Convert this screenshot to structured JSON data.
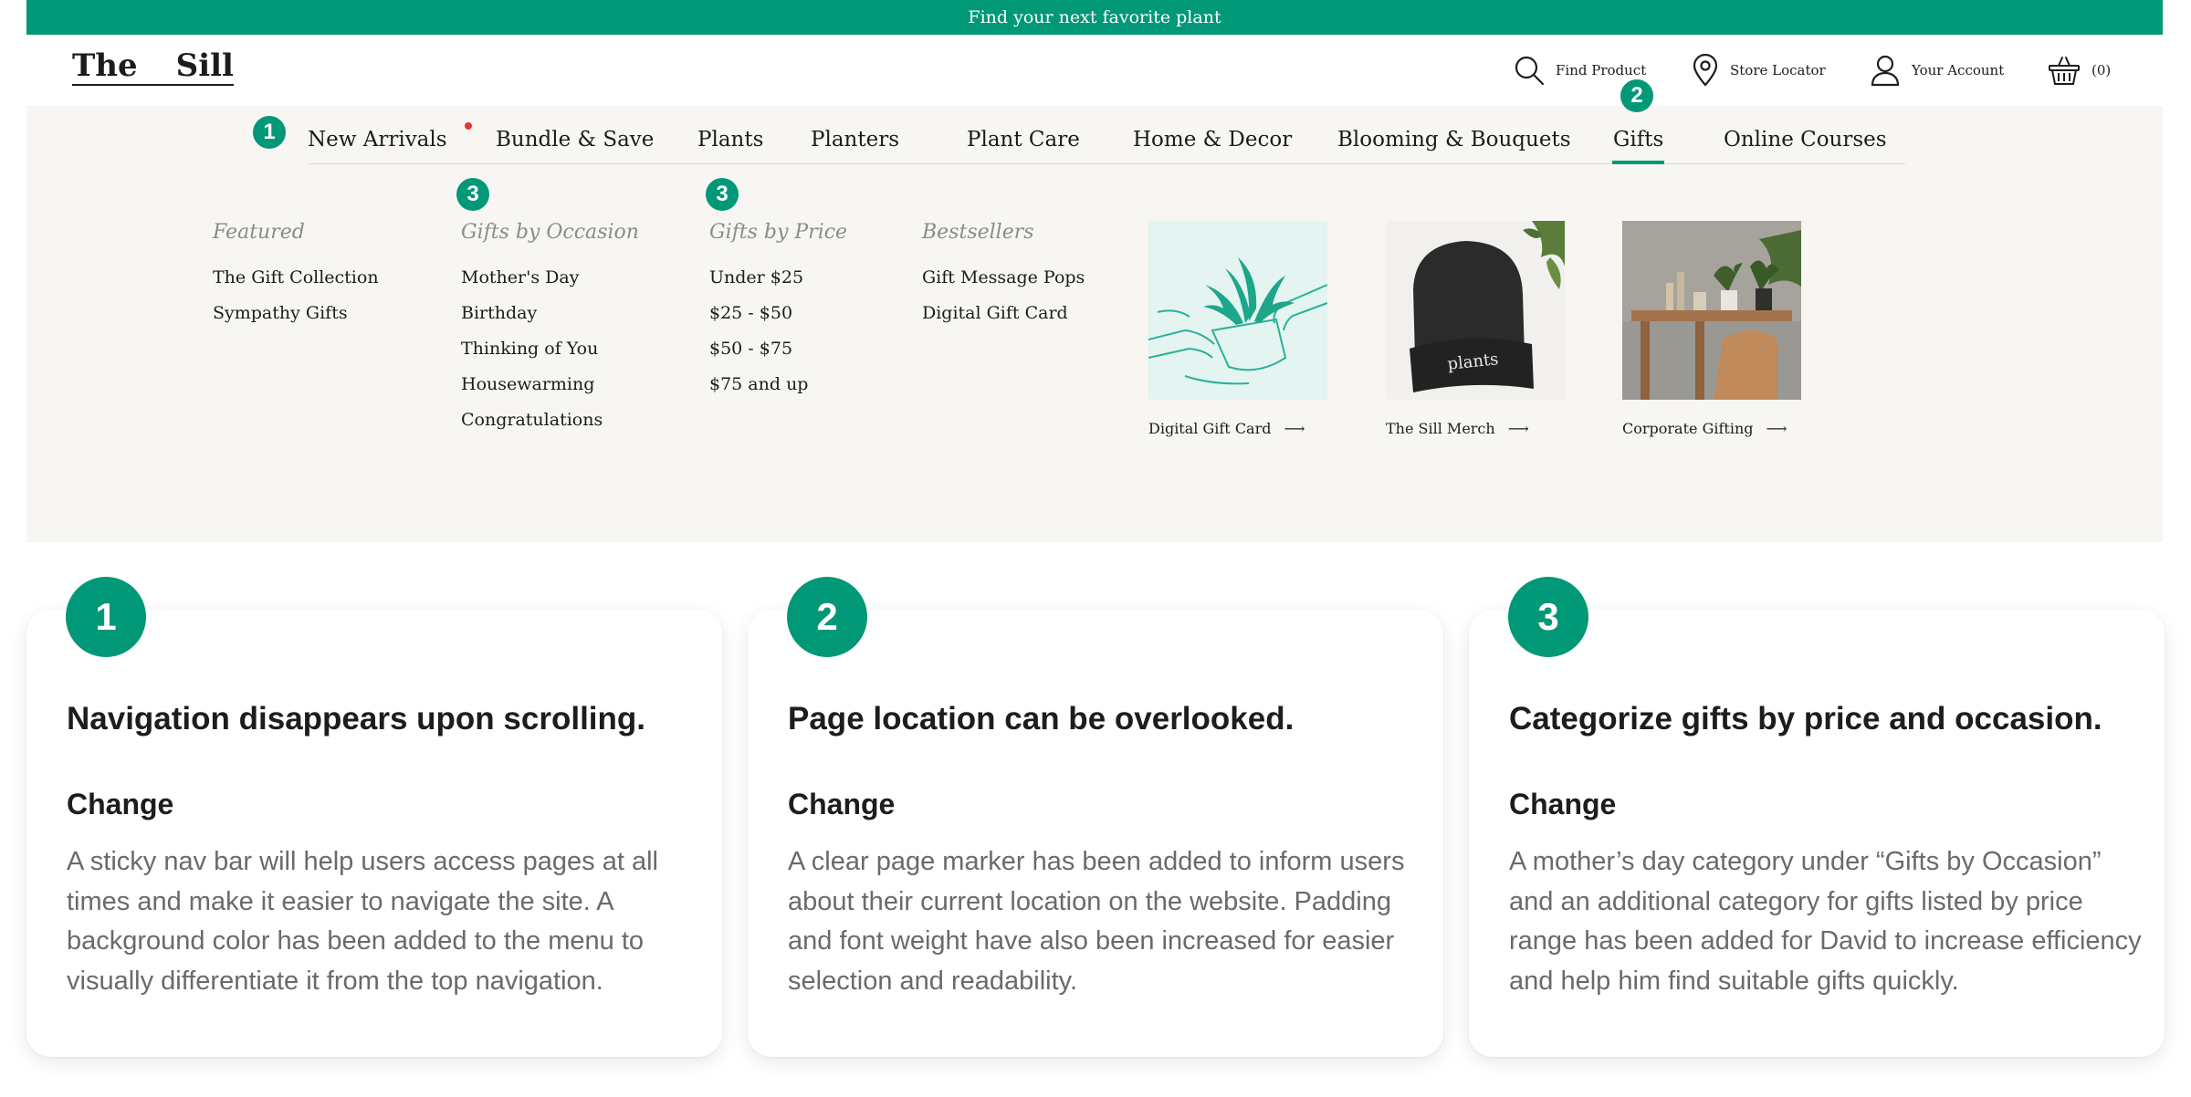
{
  "banner": {
    "text": "Find your next favorite plant"
  },
  "logo": {
    "word1": "The",
    "word2": "Sill"
  },
  "utility": {
    "find": "Find Product",
    "store": "Store Locator",
    "account": "Your Account",
    "cart": "(0)"
  },
  "nav": {
    "items": [
      "New Arrivals",
      "Bundle & Save",
      "Plants",
      "Planters",
      "Plant Care",
      "Home & Decor",
      "Blooming & Bouquets",
      "Gifts",
      "Online Courses"
    ],
    "active": "Gifts"
  },
  "markers": [
    "1",
    "2",
    "3",
    "3"
  ],
  "menu": {
    "featured": {
      "heading": "Featured",
      "links": [
        "The Gift Collection",
        "Sympathy Gifts"
      ]
    },
    "occasion": {
      "heading": "Gifts by Occasion",
      "links": [
        "Mother's Day",
        "Birthday",
        "Thinking of You",
        "Housewarming",
        "Congratulations"
      ]
    },
    "price": {
      "heading": "Gifts by Price",
      "links": [
        "Under $25",
        "$25 - $50",
        "$50 - $75",
        "$75 and up"
      ]
    },
    "bestsellers": {
      "heading": "Bestsellers",
      "links": [
        "Gift Message Pops",
        "Digital Gift Card"
      ]
    }
  },
  "promos": [
    {
      "caption": "Digital Gift Card",
      "icon": "plant-gift-illustration"
    },
    {
      "caption": "The Sill Merch",
      "image_text": "plants",
      "icon": "beanie-photo"
    },
    {
      "caption": "Corporate Gifting",
      "icon": "office-plants-photo"
    }
  ],
  "cards": [
    {
      "number": "1",
      "title": "Navigation disappears upon scrolling.",
      "subtitle": "Change",
      "body": "A sticky nav bar will help users access pages at all times and make it easier to navigate the site. A background color has been added to the menu to visually differentiate it from the top navigation."
    },
    {
      "number": "2",
      "title": "Page location can be overlooked.",
      "subtitle": "Change",
      "body": "A clear page marker has been added to inform users about their current location on the website. Padding and font weight have also been increased for easier selection and readability."
    },
    {
      "number": "3",
      "title": "Categorize gifts by price and occasion.",
      "subtitle": "Change",
      "body": "A mother’s day category under “Gifts by Occasion” and an additional category for gifts listed by price range has been added for David to increase efficiency and help him find suitable gifts quickly."
    }
  ],
  "colors": {
    "brand": "#009877",
    "panel": "#f7f6f3",
    "new_dot": "#e8332e"
  }
}
